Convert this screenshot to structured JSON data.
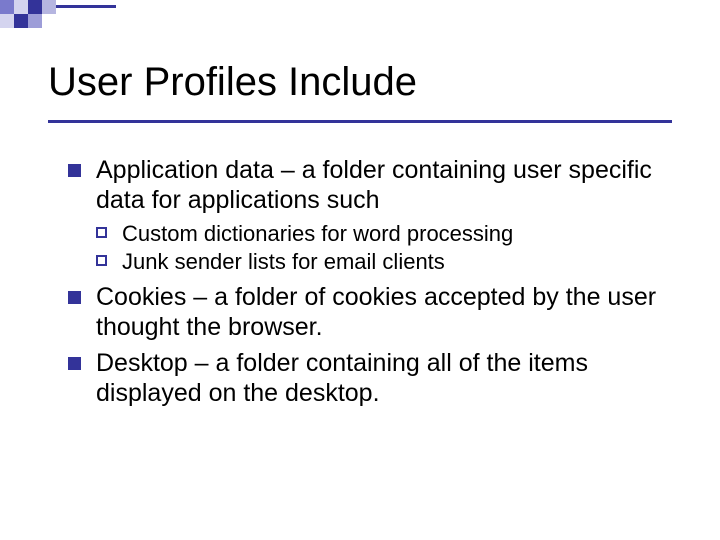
{
  "title": "User Profiles Include",
  "bullets": {
    "b1": "Application data – a folder containing user specific data for applications such",
    "b1_sub1": "Custom dictionaries for word processing",
    "b1_sub2": "Junk sender lists for email clients",
    "b2": "Cookies – a folder of cookies accepted by the user thought the browser.",
    "b3": "Desktop – a folder containing all of the items displayed on the desktop."
  }
}
